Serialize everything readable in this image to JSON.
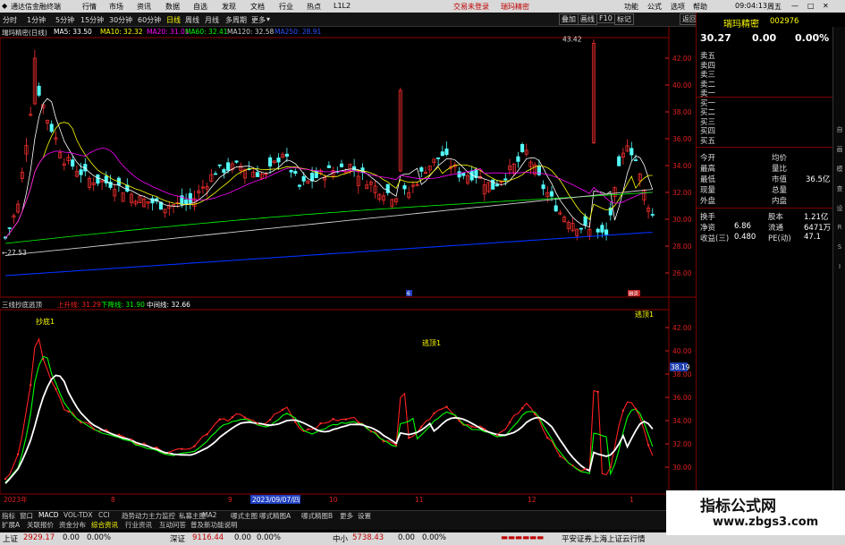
{
  "app": {
    "title": "通达信金融终端",
    "header_tabs": [
      "行情",
      "市场",
      "资讯",
      "数据",
      "自选",
      "发现",
      "文档",
      "行业",
      "热点",
      "L1L2"
    ],
    "trade_labels": [
      "交易未登录",
      "瑞玛精密"
    ],
    "right_menu": [
      "功能",
      "公式",
      "选项",
      "帮助"
    ],
    "time": "09:04:13",
    "weekday": "周五"
  },
  "toolbar": {
    "periods": [
      "分时",
      "1分钟",
      "5分钟",
      "15分钟",
      "30分钟",
      "60分钟",
      "日线",
      "周线",
      "月线",
      "多周期",
      "更多"
    ],
    "selected_period": "日线",
    "right_buttons": [
      "叠加",
      "画线",
      "F10",
      "标记",
      "返回"
    ]
  },
  "main_chart": {
    "header_name": "瑞玛精密(日线)",
    "ma_labels": [
      "MA5: 33.50",
      "MA10: 32.32",
      "MA20: 31.01",
      "MA60: 32.41",
      "MA120: 32.58",
      "MA250: 28.91"
    ],
    "ma_colors": [
      "#ffffff",
      "#ffff00",
      "#ff00ff",
      "#00ff00",
      "#d0d0d0",
      "#0030ff"
    ],
    "yticks": [
      "42.00",
      "40.00",
      "38.00",
      "36.00",
      "34.00",
      "32.00",
      "30.00",
      "28.00",
      "26.00"
    ],
    "annot_high": "43.42",
    "annot_low": "27.53",
    "badge_left": "6",
    "badge_right": "融资"
  },
  "sub_chart": {
    "title": "三线抄底逃顶",
    "labels": [
      "上升线: 31.29",
      "下降线: 31.90",
      "中间线: 32.66"
    ],
    "label_colors": [
      "#ff2020",
      "#00ff00",
      "#ffffff"
    ],
    "yticks": [
      "42.00",
      "40.00",
      "38.00",
      "36.00",
      "34.00",
      "32.00",
      "30.00"
    ],
    "current_tag": "38.19",
    "signals": [
      "抄底1",
      "逃顶1",
      "逃顶1"
    ]
  },
  "date_axis": {
    "labels": [
      "2023年",
      "8",
      "9",
      "2023/09/07/四",
      "10",
      "11",
      "12",
      "1"
    ]
  },
  "quote": {
    "name": "瑞玛精密",
    "code": "002976",
    "price": "30.27",
    "change": "0.00",
    "pct": "0.00%",
    "orderbook": [
      "卖五",
      "卖四",
      "卖三",
      "卖二",
      "卖一",
      "买一",
      "买二",
      "买三",
      "买四",
      "买五"
    ],
    "stats_left": [
      "今开",
      "最高",
      "最低",
      "现量",
      "外盘"
    ],
    "stats_right": [
      "均价",
      "量比",
      "市值",
      "总量",
      "内盘"
    ],
    "mcap": "36.5亿",
    "extra": [
      {
        "label": "换手",
        "value": "",
        "label2": "股本",
        "value2": "1.21亿"
      },
      {
        "label": "净资",
        "value": "6.86",
        "label2": "流通",
        "value2": "6471万"
      },
      {
        "label": "收益(三)",
        "value": "0.480",
        "label2": "PE(动)",
        "value2": "47.1"
      }
    ]
  },
  "indicator_tabs": [
    "指标",
    "窗口",
    "MACD",
    "VOL-TDX",
    "CCI",
    "趋势动力",
    "主力监控",
    "私募主图",
    "MA2",
    "哪式主图",
    "哪式精图A",
    "哪式精图B",
    "更多",
    "设置"
  ],
  "bottom_tabs": [
    "扩展A",
    "关联报价",
    "资金分布",
    "综合资讯",
    "行业资讯",
    "互动问答",
    "普及新功能说明"
  ],
  "status": {
    "items": [
      {
        "name": "上证",
        "value": "2929.17",
        "chg": "0.00",
        "pct": "0.00%"
      },
      {
        "name": "深证",
        "value": "9116.44",
        "chg": "0.00",
        "pct": "0.00%"
      },
      {
        "name": "中小",
        "value": "5738.43",
        "chg": "0.00",
        "pct": "0.00%"
      }
    ],
    "broker": "平安证券上海上证云行情"
  },
  "watermark": {
    "line1": "指标公式网",
    "line2": "www.zbgs3.com"
  },
  "scroll_icons": [
    "自",
    "画",
    "模",
    "查",
    "设",
    "R",
    "S",
    "I"
  ]
}
